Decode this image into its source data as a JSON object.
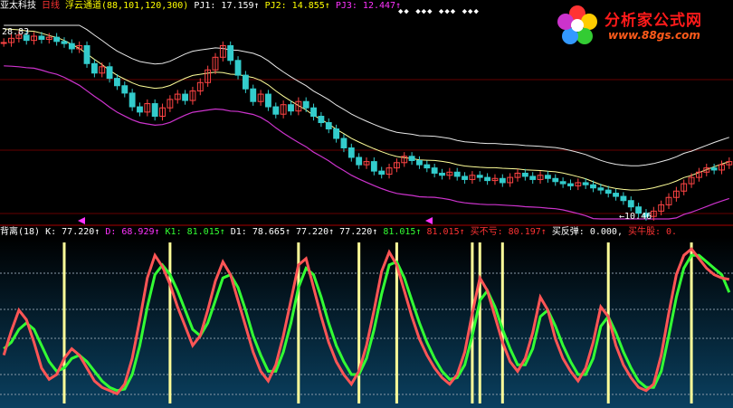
{
  "header": {
    "stock": "亚太科技",
    "period": "日线",
    "indicator": "浮云通道(88,101,120,300)",
    "pj1": "PJ1: 17.159↑",
    "pj2": "PJ2: 14.855↑",
    "pj3": "PJ3: 12.447↑"
  },
  "price_panel": {
    "high_label": "28.83",
    "low_label": "←10.46",
    "star_marks": "◆◆ ◆◆◆  ◆◆◆ ◆◆◆"
  },
  "indicator_panel": {
    "name": "背离(18)",
    "k": "K: 77.220↑",
    "d": "D: 68.929↑",
    "k1": "K1: 81.015↑",
    "d1": "D1: 78.665↑",
    "v1": "77.220↑",
    "v2": "77.220↑",
    "v3": "81.015↑",
    "v4": "81.015↑",
    "buy_no_loss": "买不亏: 80.197↑",
    "buy_rebound": "买反弹: 0.000,",
    "buy_bull": "买牛股: 0."
  },
  "logo": {
    "title": "分析家公式网",
    "url": "www.88gs.com"
  },
  "colors": {
    "background": "#000000",
    "channel_upper": "#e8e8e8",
    "channel_mid": "#ffff99",
    "channel_lower": "#cc33cc",
    "candle_up": "#ff4444",
    "candle_down": "#33cccc",
    "k_line": "#ff5555",
    "d_line": "#33ff33",
    "signal_bar": "#ffff99",
    "panel_gradient_top": "#000000",
    "panel_gradient_bottom": "#0a4060"
  },
  "chart_data": [
    {
      "type": "candlestick",
      "title": "亚太科技 日线 浮云通道(88,101,120,300)",
      "series": [
        {
          "name": "PJ1",
          "last": 17.159
        },
        {
          "name": "PJ2",
          "last": 14.855
        },
        {
          "name": "PJ3",
          "last": 12.447
        }
      ],
      "close": [
        27.2,
        27.6,
        27.9,
        27.4,
        27.8,
        27.5,
        27.7,
        27.3,
        27.1,
        26.6,
        26.9,
        25.2,
        24.3,
        24.9,
        23.8,
        23.1,
        22.4,
        21.1,
        20.6,
        21.4,
        20.2,
        21.0,
        21.8,
        22.3,
        21.7,
        22.6,
        23.4,
        24.6,
        25.8,
        26.9,
        25.5,
        24.1,
        22.8,
        21.6,
        22.3,
        21.1,
        20.4,
        21.3,
        20.7,
        21.6,
        21.0,
        20.2,
        19.6,
        19.0,
        18.1,
        17.2,
        16.3,
        15.6,
        15.9,
        15.0,
        14.7,
        15.3,
        15.8,
        16.4,
        16.0,
        15.6,
        15.3,
        14.8,
        14.6,
        14.9,
        14.5,
        14.2,
        14.6,
        14.4,
        14.1,
        14.3,
        13.9,
        14.4,
        14.8,
        14.5,
        14.2,
        14.6,
        14.3,
        14.0,
        13.8,
        13.6,
        13.9,
        13.7,
        13.4,
        13.2,
        12.9,
        12.6,
        12.2,
        11.6,
        11.0,
        10.7,
        11.2,
        11.8,
        12.5,
        13.1,
        13.8,
        14.4,
        14.9,
        15.3,
        15.1,
        15.6,
        15.9
      ],
      "high": 28.83,
      "low": 10.46
    },
    {
      "type": "line",
      "title": "背离(18)",
      "series": [
        {
          "name": "K",
          "last": 77.22
        },
        {
          "name": "D",
          "last": 68.929
        },
        {
          "name": "K1",
          "last": 81.015
        },
        {
          "name": "D1",
          "last": 78.665
        },
        {
          "name": "买不亏",
          "last": 80.197
        },
        {
          "name": "买反弹",
          "last": 0.0
        }
      ],
      "ylim": [
        0,
        100
      ],
      "k": [
        30,
        45,
        58,
        52,
        38,
        22,
        15,
        18,
        28,
        34,
        30,
        22,
        14,
        10,
        8,
        6,
        12,
        28,
        52,
        78,
        92,
        85,
        74,
        60,
        48,
        36,
        42,
        58,
        76,
        88,
        80,
        64,
        48,
        32,
        20,
        14,
        24,
        42,
        64,
        86,
        90,
        72,
        54,
        38,
        26,
        18,
        12,
        20,
        36,
        58,
        82,
        94,
        86,
        70,
        54,
        40,
        30,
        22,
        16,
        12,
        18,
        32,
        56,
        78,
        70,
        54,
        38,
        26,
        20,
        28,
        44,
        66,
        58,
        40,
        28,
        20,
        14,
        22,
        38,
        60,
        54,
        36,
        24,
        16,
        10,
        8,
        12,
        30,
        56,
        80,
        92,
        96,
        90,
        84,
        80,
        78,
        77
      ],
      "d": [
        34,
        38,
        46,
        50,
        46,
        36,
        26,
        20,
        22,
        28,
        30,
        26,
        20,
        14,
        10,
        8,
        9,
        18,
        36,
        60,
        80,
        86,
        80,
        70,
        58,
        46,
        42,
        50,
        64,
        78,
        80,
        72,
        58,
        42,
        30,
        20,
        20,
        32,
        50,
        72,
        84,
        80,
        66,
        50,
        36,
        26,
        18,
        18,
        28,
        46,
        68,
        86,
        88,
        78,
        64,
        50,
        38,
        28,
        20,
        15,
        16,
        24,
        42,
        64,
        70,
        60,
        46,
        34,
        24,
        24,
        34,
        54,
        58,
        48,
        36,
        26,
        18,
        18,
        28,
        48,
        54,
        44,
        32,
        22,
        14,
        10,
        10,
        20,
        42,
        66,
        84,
        92,
        92,
        88,
        84,
        80,
        69
      ],
      "signals": [
        8,
        22,
        39,
        47,
        52,
        62,
        63,
        66,
        80,
        91
      ]
    }
  ]
}
